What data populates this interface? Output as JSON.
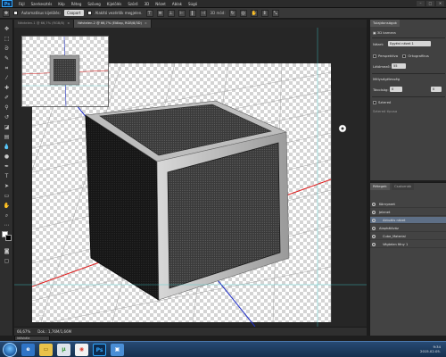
{
  "menu": {
    "logo": "Ps",
    "items": [
      "Fájl",
      "Szerkesztés",
      "Kép",
      "Réteg",
      "Szöveg",
      "Kijelölés",
      "Szűrő",
      "3D",
      "Nézet",
      "Ablak",
      "Súgó"
    ]
  },
  "window_controls": [
    "–",
    "□",
    "✕"
  ],
  "options": {
    "auto_select_label": "Automatikus kijelölés:",
    "auto_select_value": "Csoport",
    "transform_label": "Alakító vezérlők megjelen.",
    "mode_label": "3D mód:"
  },
  "tabs": [
    {
      "label": "Névtelen-1 @ 66,7% (RGB/8)",
      "active": false
    },
    {
      "label": "Névtelen-2 @ 66,7% (Előlap, RGB/8/3D)",
      "active": true
    }
  ],
  "panel": {
    "tab_label": "Tulajdonságok",
    "type_label": "3D kamera",
    "view_label": "Nézet:",
    "view_value": "Egyéni nézet 1",
    "perspective_label": "Perspektíva",
    "ortho_label": "Ortografikus",
    "fov_label": "Látómező:",
    "fov_value": "55",
    "depth_label": "Mélységélesség",
    "distance_label": "Távolság:",
    "distance_value": "0",
    "depth_value": "0",
    "stereo_label": "Sztereó",
    "stereo_type_label": "Sztereó típusa"
  },
  "layers": {
    "tabs": [
      "Rétegek",
      "Csatornák"
    ],
    "rows": [
      {
        "name": "Környezet",
        "selected": false
      },
      {
        "name": "Jelenet",
        "selected": false
      },
      {
        "name": "Aktuális nézet",
        "selected": true
      },
      {
        "name": "Alaphálóváz",
        "selected": false
      },
      {
        "name": "Cube_Material",
        "selected": false
      },
      {
        "name": "Végtelen fény 1",
        "selected": false
      }
    ]
  },
  "status": {
    "zoom": "66,67%",
    "doc": "Dok.: 1,76M/1,66M"
  },
  "mini_tab": "Időskála",
  "taskbar": {
    "icons": [
      "e",
      "◉",
      "Ps",
      "▣"
    ],
    "time": "9:34",
    "date": "2015.02.05."
  }
}
